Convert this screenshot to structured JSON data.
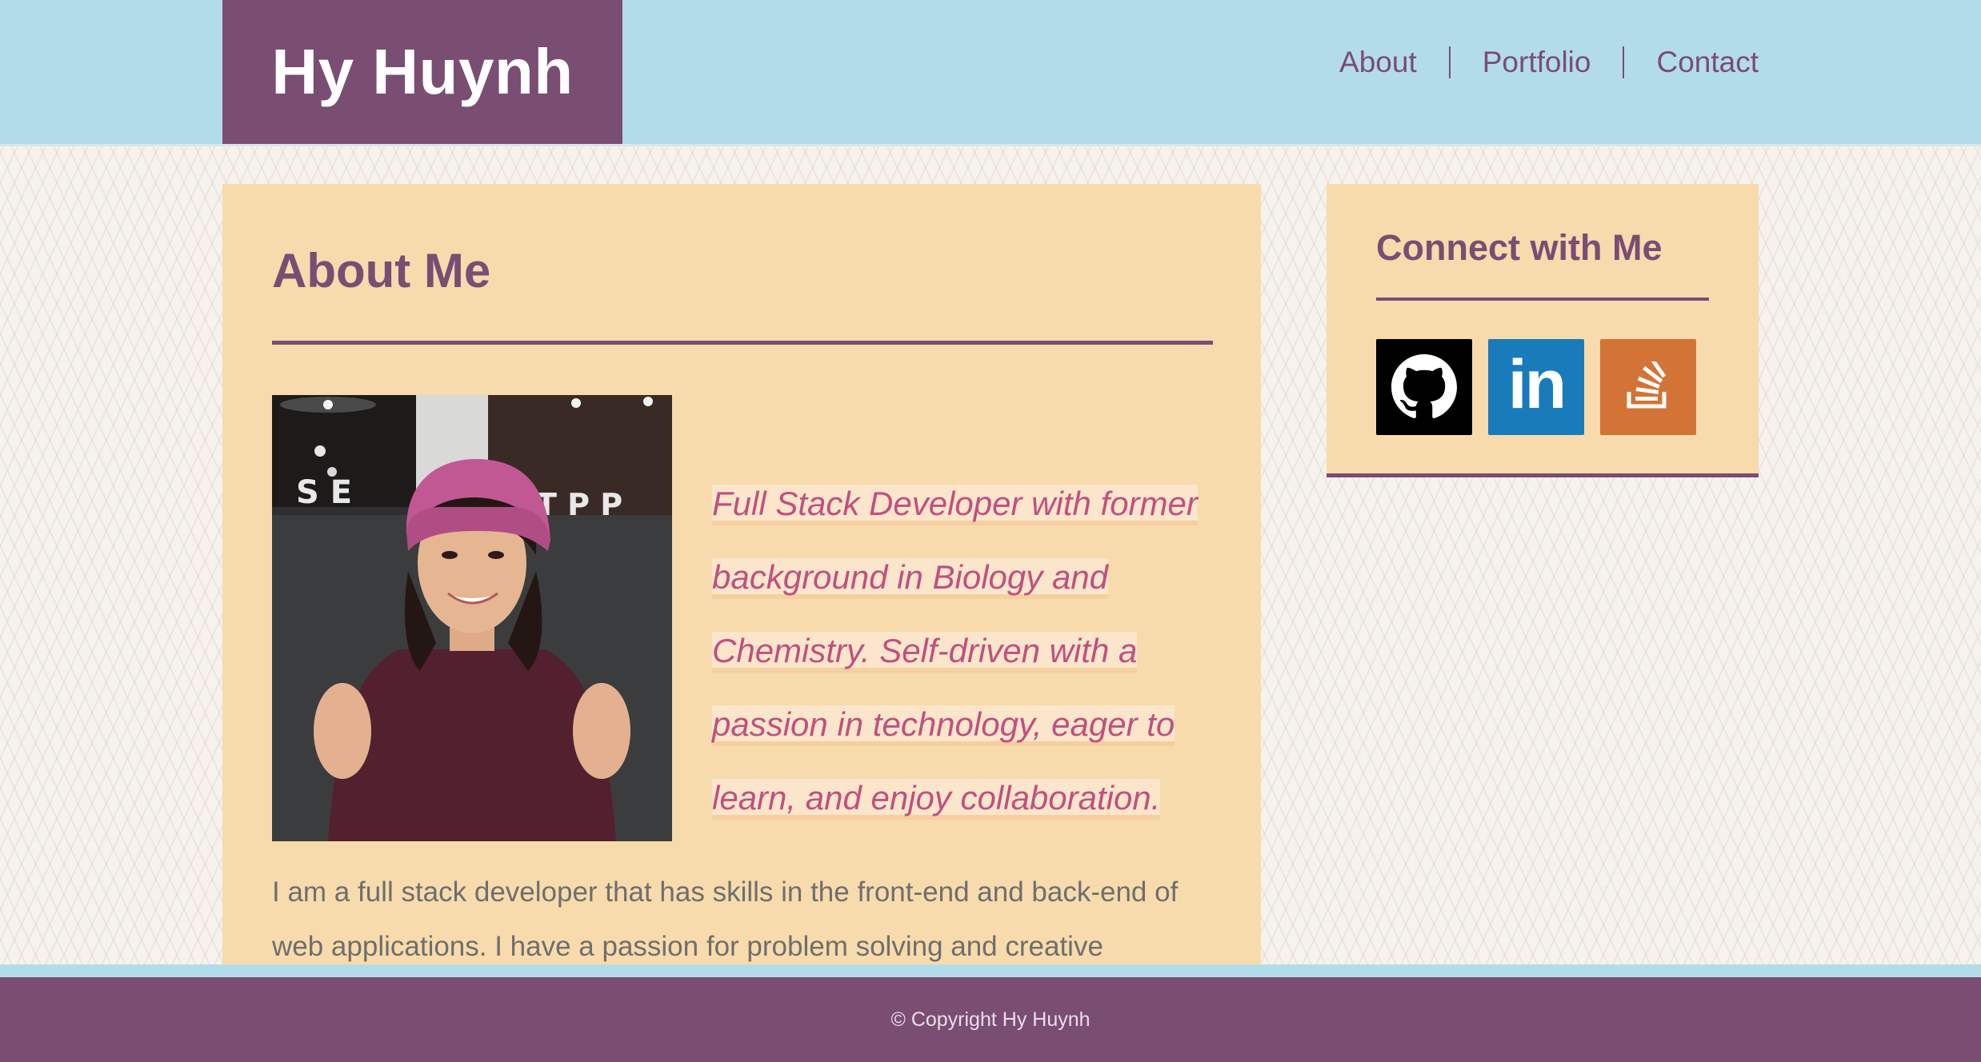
{
  "site": {
    "brand": "Hy Huynh"
  },
  "nav": {
    "items": [
      {
        "label": "About"
      },
      {
        "label": "Portfolio"
      },
      {
        "label": "Contact"
      }
    ]
  },
  "about": {
    "title": "About Me",
    "tagline": "Full Stack Developer with former background in Biology and Chemistry. Self-driven with a passion in technology, eager to learn, and enjoy collaboration.",
    "bio": "I am a full stack developer that has skills in the front-end and back-end of web applications. I have a passion for problem solving and creative"
  },
  "connect": {
    "title": "Connect with Me",
    "links": [
      {
        "icon": "github-icon",
        "color": "#000000"
      },
      {
        "icon": "linkedin-icon",
        "color": "#1a7bbb",
        "text": "in"
      },
      {
        "icon": "stackoverflow-icon",
        "color": "#d47336"
      }
    ]
  },
  "footer": {
    "copyright": "© Copyright Hy Huynh"
  },
  "colors": {
    "header_bg": "#b3dceb",
    "brand_purple": "#7a4d73",
    "card_bg": "#f8dbac",
    "tagline_pink": "#c0507f"
  }
}
